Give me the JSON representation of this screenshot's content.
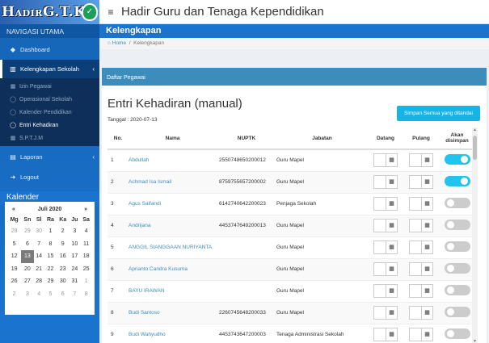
{
  "logo": {
    "text_big": "H",
    "text_small": "ADIR",
    "text_gtk": "G.T.K"
  },
  "app_title": "Hadir Guru dan Tenaga Kependidikan",
  "sidebar": {
    "nav_header": "NAVIGASI UTAMA",
    "dashboard": "Dashboard",
    "kelengkapan": "Kelengkapan Sekolah",
    "sub": [
      "Izin Pegawai",
      "Operasional Sekolah",
      "Kalender Pendidikan",
      "Entri Kehadiran",
      "S.P.T.J.M"
    ],
    "laporan": "Laporan",
    "logout": "Logout",
    "kalender": "Kalender"
  },
  "calendar": {
    "prev": "«",
    "month": "Juli 2020",
    "next": "»",
    "days": [
      "Mg",
      "Sn",
      "Sl",
      "Ra",
      "Ka",
      "Ju",
      "Sa"
    ],
    "weeks": [
      [
        "28",
        "29",
        "30",
        "1",
        "2",
        "3",
        "4"
      ],
      [
        "5",
        "6",
        "7",
        "8",
        "9",
        "10",
        "11"
      ],
      [
        "12",
        "13",
        "14",
        "15",
        "16",
        "17",
        "18"
      ],
      [
        "19",
        "20",
        "21",
        "22",
        "23",
        "24",
        "25"
      ],
      [
        "26",
        "27",
        "28",
        "29",
        "30",
        "31",
        "1"
      ],
      [
        "2",
        "3",
        "4",
        "5",
        "6",
        "7",
        "8"
      ]
    ],
    "today": "13"
  },
  "content": {
    "header": "Kelengkapan",
    "breadcrumb_home": "Home",
    "breadcrumb_sep": "/",
    "breadcrumb_current": "Kelengkapan",
    "box_title": "Daftar Pegawai",
    "entri_title": "Entri Kehadiran (manual)",
    "tanggal": "Tanggal : 2020-07-13",
    "save_button": "Simpan Semua yang ditandai"
  },
  "table": {
    "headers": {
      "no": "No.",
      "nama": "Nama",
      "nuptk": "NUPTK",
      "jabatan": "Jabatan",
      "datang": "Datang",
      "pulang": "Pulang",
      "akan": "Akan disimpan"
    },
    "rows": [
      {
        "no": "1",
        "nama": "Abdullah",
        "nuptk": "2550748650200012",
        "jabatan": "Guru Mapel",
        "save": true
      },
      {
        "no": "2",
        "nama": "Achmad Isa Ismail",
        "nuptk": "8759755657200002",
        "jabatan": "Guru Mapel",
        "save": true
      },
      {
        "no": "3",
        "nama": "Agus Saifandi",
        "nuptk": "6142740642200023",
        "jabatan": "Penjaga Sekolah",
        "save": false
      },
      {
        "no": "4",
        "nama": "Andrijana",
        "nuptk": "4453747649200013",
        "jabatan": "Guru Mapel",
        "save": false
      },
      {
        "no": "5",
        "nama": "ANGGIL SIANGGAAN NURIYANTA",
        "nuptk": "",
        "jabatan": "Guru Mapel",
        "save": false
      },
      {
        "no": "6",
        "nama": "Aprianto Candra Kusuma",
        "nuptk": "",
        "jabatan": "Guru Mapel",
        "save": false
      },
      {
        "no": "7",
        "nama": "BAYU IRAWAN",
        "nuptk": "",
        "jabatan": "Guru Mapel",
        "save": false
      },
      {
        "no": "8",
        "nama": "Budi Santoso",
        "nuptk": "2260745648200033",
        "jabatan": "Guru Mapel",
        "save": false
      },
      {
        "no": "9",
        "nama": "Budi Wahyudho",
        "nuptk": "4453743647200003",
        "jabatan": "Tenaga Administrasi Sekolah",
        "save": false
      }
    ]
  },
  "icons": {
    "hamburger": "≡",
    "home": "⌂",
    "calendar": "▦",
    "dashboard": "◆",
    "school": "▥",
    "laporan": "▤",
    "logout": "➜",
    "caret_left": "‹",
    "circle": "◯",
    "scroll_up": "▲",
    "scroll_down": "▼"
  },
  "colors": {
    "sidebar": "#1a74cf",
    "header": "#1a73cf",
    "save_button": "#16b3e6",
    "toggle_on": "#21c3ef"
  }
}
